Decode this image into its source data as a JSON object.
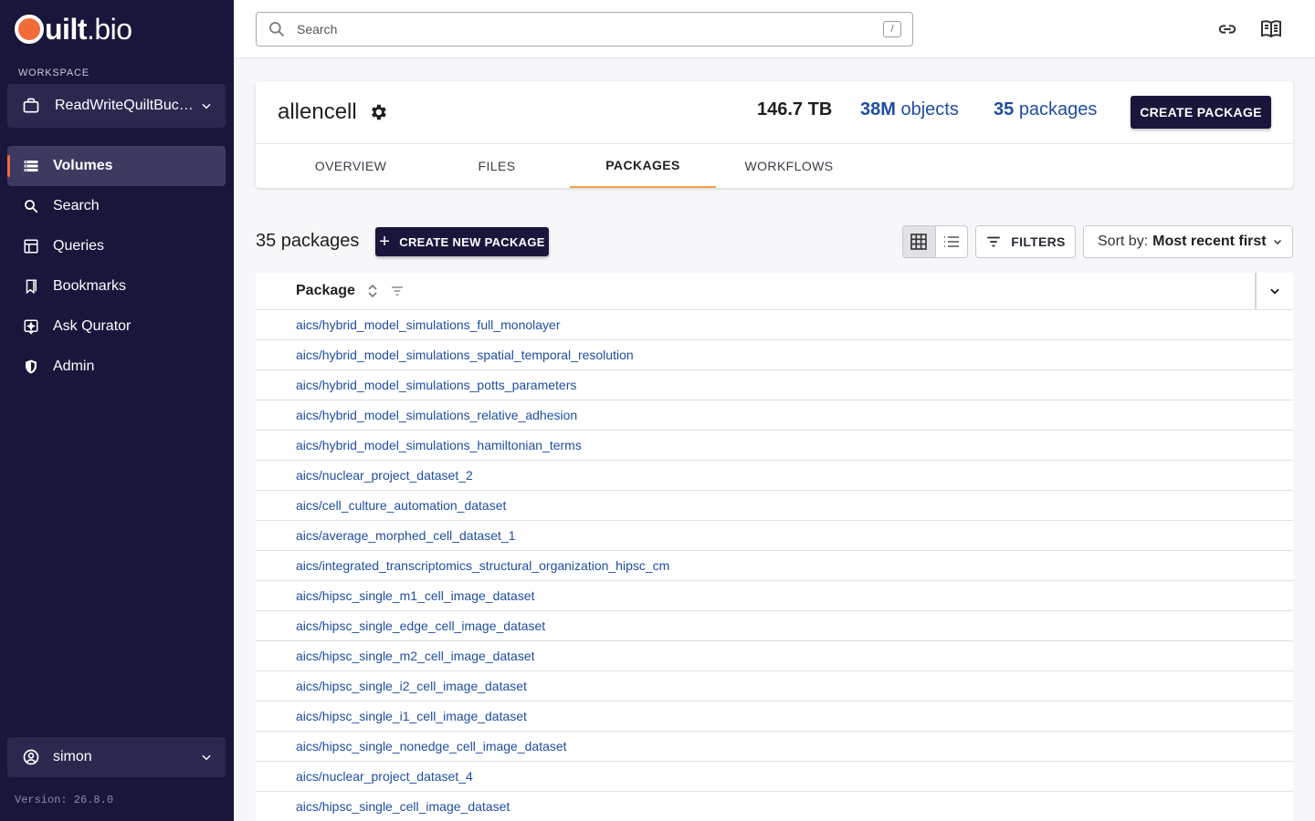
{
  "brand": {
    "name_bold": "uilt",
    "name_light": ".bio",
    "accent": "#f26b3a",
    "sidebar_bg": "#19163b"
  },
  "workspace": {
    "label": "WORKSPACE",
    "selected": "ReadWriteQuiltBuck…"
  },
  "nav": [
    {
      "label": "Volumes",
      "icon": "volumes-icon",
      "active": true
    },
    {
      "label": "Search",
      "icon": "search-icon"
    },
    {
      "label": "Queries",
      "icon": "table-icon"
    },
    {
      "label": "Bookmarks",
      "icon": "bookmark-icon"
    },
    {
      "label": "Ask Qurator",
      "icon": "sparkle-icon"
    },
    {
      "label": "Admin",
      "icon": "shield-icon"
    }
  ],
  "user": {
    "name": "simon"
  },
  "version": "Version: 26.8.0",
  "search": {
    "placeholder": "Search",
    "shortcut": "/"
  },
  "bucket": {
    "name": "allencell",
    "size": "146.7 TB",
    "objects_count": "38M",
    "objects_label": "objects",
    "packages_count": "35",
    "packages_label": "packages",
    "create_label": "CREATE PACKAGE"
  },
  "tabs": [
    {
      "label": "OVERVIEW"
    },
    {
      "label": "FILES"
    },
    {
      "label": "PACKAGES",
      "active": true
    },
    {
      "label": "WORKFLOWS"
    }
  ],
  "packages": {
    "count_label": "35 packages",
    "create_new_label": "CREATE NEW PACKAGE",
    "filters_label": "FILTERS",
    "sort_prefix": "Sort by:",
    "sort_value": "Most recent first",
    "column_header": "Package",
    "rows": [
      "aics/hybrid_model_simulations_full_monolayer",
      "aics/hybrid_model_simulations_spatial_temporal_resolution",
      "aics/hybrid_model_simulations_potts_parameters",
      "aics/hybrid_model_simulations_relative_adhesion",
      "aics/hybrid_model_simulations_hamiltonian_terms",
      "aics/nuclear_project_dataset_2",
      "aics/cell_culture_automation_dataset",
      "aics/average_morphed_cell_dataset_1",
      "aics/integrated_transcriptomics_structural_organization_hipsc_cm",
      "aics/hipsc_single_m1_cell_image_dataset",
      "aics/hipsc_single_edge_cell_image_dataset",
      "aics/hipsc_single_m2_cell_image_dataset",
      "aics/hipsc_single_i2_cell_image_dataset",
      "aics/hipsc_single_i1_cell_image_dataset",
      "aics/hipsc_single_nonedge_cell_image_dataset",
      "aics/nuclear_project_dataset_4",
      "aics/hipsc_single_cell_image_dataset"
    ]
  }
}
